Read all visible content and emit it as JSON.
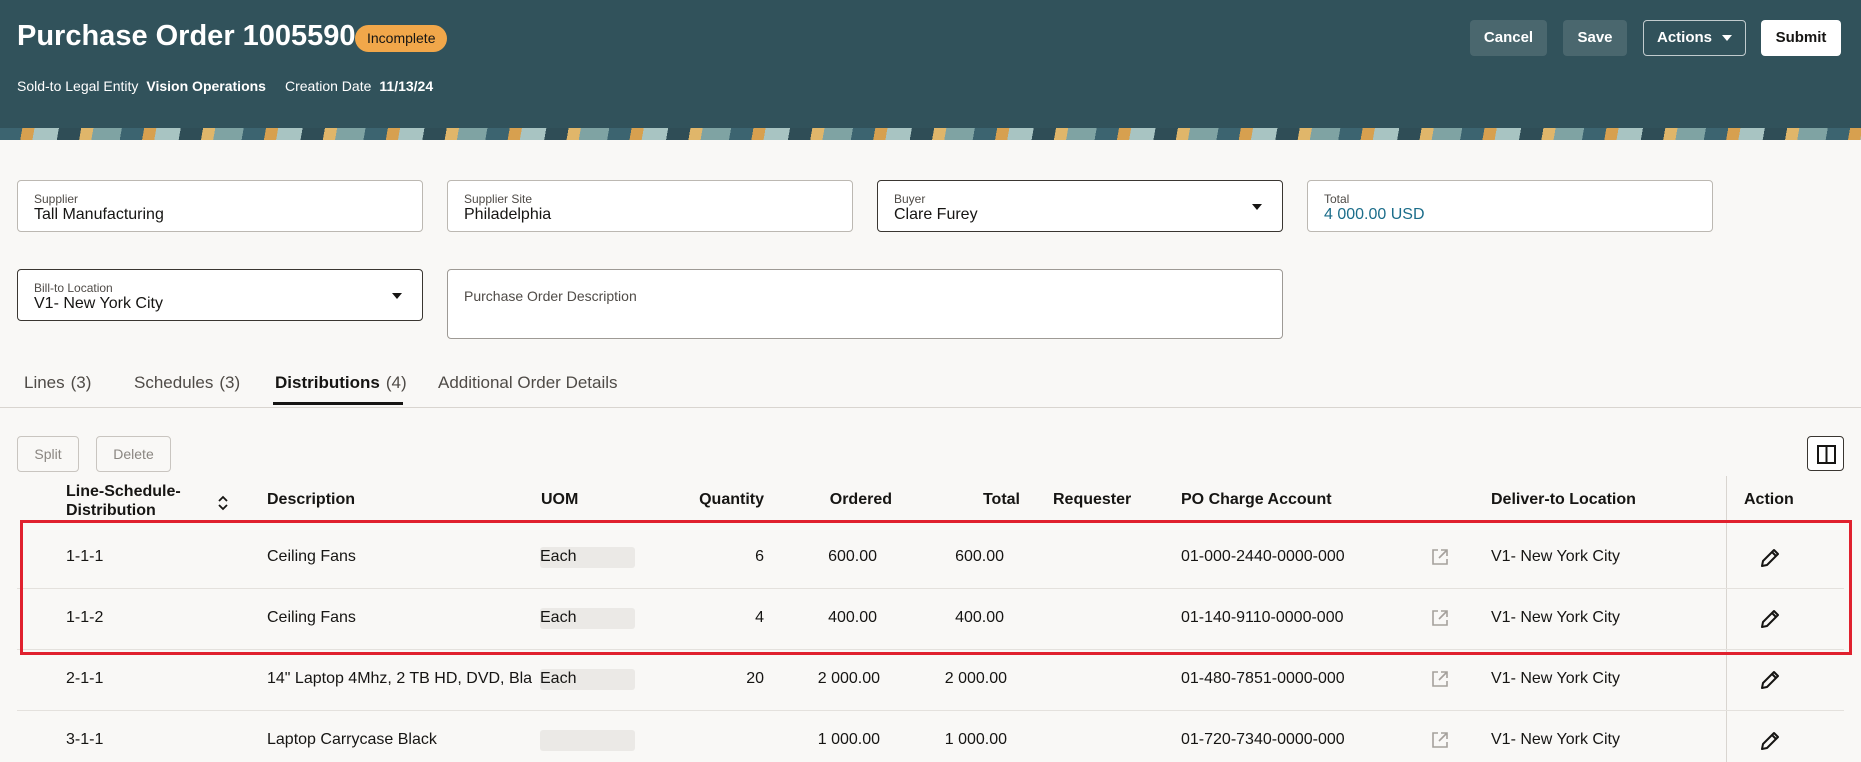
{
  "header": {
    "title": "Purchase Order 1005590",
    "status": "Incomplete",
    "sold_to_label": "Sold-to Legal Entity",
    "sold_to_value": "Vision Operations",
    "creation_date_label": "Creation Date",
    "creation_date_value": "11/13/24",
    "buttons": {
      "cancel": "Cancel",
      "save": "Save",
      "actions": "Actions",
      "submit": "Submit"
    }
  },
  "fields": {
    "supplier": {
      "label": "Supplier",
      "value": "Tall Manufacturing"
    },
    "supplier_site": {
      "label": "Supplier Site",
      "value": "Philadelphia"
    },
    "buyer": {
      "label": "Buyer",
      "value": "Clare Furey"
    },
    "total": {
      "label": "Total",
      "value": "4 000.00 USD"
    },
    "bill_to": {
      "label": "Bill-to Location",
      "value": "V1- New York City"
    },
    "description": {
      "label": "Purchase Order Description",
      "value": ""
    }
  },
  "tabs": [
    {
      "label": "Lines",
      "count": "(3)"
    },
    {
      "label": "Schedules",
      "count": "(3)"
    },
    {
      "label": "Distributions",
      "count": "(4)"
    },
    {
      "label": "Additional Order Details",
      "count": ""
    }
  ],
  "toolbar": {
    "split": "Split",
    "delete": "Delete"
  },
  "table": {
    "headers": {
      "line": [
        "Line-Schedule-",
        "Distribution"
      ],
      "description": "Description",
      "uom": "UOM",
      "quantity": "Quantity",
      "ordered": "Ordered",
      "total": "Total",
      "requester": "Requester",
      "charge_account": "PO Charge Account",
      "deliver_to": "Deliver-to Location",
      "action": "Action"
    },
    "rows": [
      {
        "line": "1-1-1",
        "description": "Ceiling Fans",
        "uom": "Each",
        "quantity": "6",
        "ordered": "600.00",
        "total": "600.00",
        "requester": "",
        "charge_account": "01-000-2440-0000-000",
        "deliver_to": "V1- New York City"
      },
      {
        "line": "1-1-2",
        "description": "Ceiling Fans",
        "uom": "Each",
        "quantity": "4",
        "ordered": "400.00",
        "total": "400.00",
        "requester": "",
        "charge_account": "01-140-9110-0000-000",
        "deliver_to": "V1- New York City"
      },
      {
        "line": "2-1-1",
        "description": "14\" Laptop 4Mhz, 2 TB HD, DVD, Bla",
        "uom": "Each",
        "quantity": "20",
        "ordered": "2 000.00",
        "total": "2 000.00",
        "requester": "",
        "charge_account": "01-480-7851-0000-000",
        "deliver_to": "V1- New York City"
      },
      {
        "line": "3-1-1",
        "description": "Laptop Carrycase Black",
        "uom": "",
        "quantity": "",
        "ordered": "1 000.00",
        "total": "1 000.00",
        "requester": "",
        "charge_account": "01-720-7340-0000-000",
        "deliver_to": "V1- New York City"
      }
    ]
  },
  "colors": {
    "header_bg": "#31525b",
    "badge": "#f1a74a",
    "highlight": "#e0212e",
    "link": "#1b6d8a"
  }
}
